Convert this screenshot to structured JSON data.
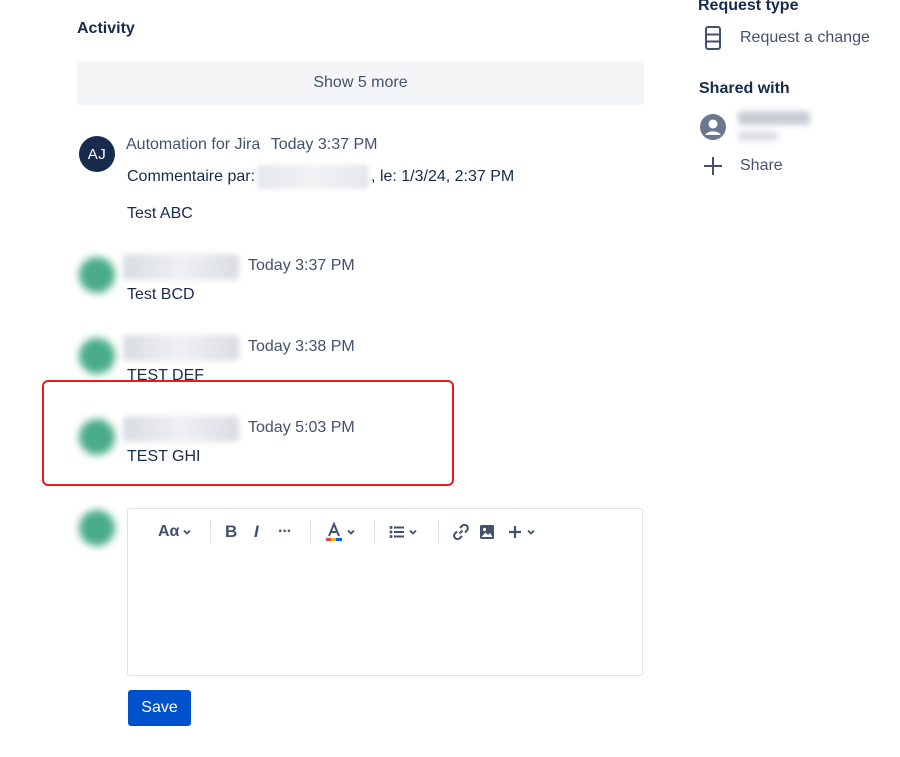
{
  "activity": {
    "title": "Activity",
    "show_more_label": "Show 5 more"
  },
  "comments": [
    {
      "author": "Automation for Jira",
      "avatar_initials": "AJ",
      "time": "Today 3:37 PM",
      "line1_prefix": "Commentaire par:",
      "line1_suffix": ", le: 1/3/24, 2:37 PM",
      "body": "Test ABC"
    },
    {
      "time": "Today 3:37 PM",
      "body": "Test BCD"
    },
    {
      "time": "Today 3:38 PM",
      "body": "TEST DEF"
    },
    {
      "time": "Today 5:03 PM",
      "body": "TEST GHI"
    }
  ],
  "editor": {
    "text_style_label": "Aα",
    "bold_label": "B",
    "italic_label": "I",
    "more_label": "···",
    "save_label": "Save"
  },
  "sidebar": {
    "request_type_heading": "Request type",
    "request_type_value": "Request a change",
    "shared_with_heading": "Shared with",
    "share_label": "Share"
  },
  "colors": {
    "highlight": "#e51c1c",
    "primary_button": "#0052cc",
    "avatar_dark": "#172b4d",
    "avatar_green": "#36a37b"
  },
  "icons": {
    "request_type": "request-change-icon",
    "shared_user": "user-avatar-icon",
    "share": "plus-icon"
  }
}
